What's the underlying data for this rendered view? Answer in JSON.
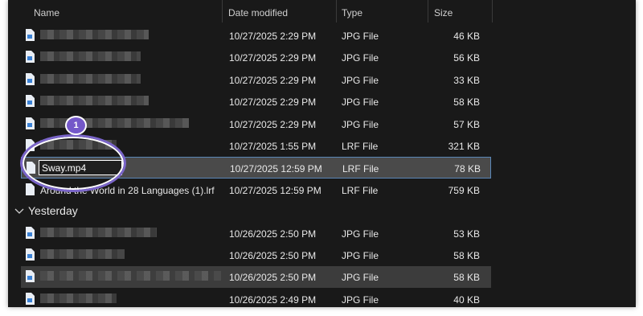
{
  "header": {
    "name": "Name",
    "date_modified": "Date modified",
    "type": "Type",
    "size": "Size"
  },
  "rows_top": [
    {
      "date": "10/27/2025 2:29 PM",
      "type": "JPG File",
      "size": "46 KB"
    },
    {
      "date": "10/27/2025 2:29 PM",
      "type": "JPG File",
      "size": "56 KB"
    },
    {
      "date": "10/27/2025 2:29 PM",
      "type": "JPG File",
      "size": "33 KB"
    },
    {
      "date": "10/27/2025 2:29 PM",
      "type": "JPG File",
      "size": "58 KB"
    },
    {
      "date": "10/27/2025 2:29 PM",
      "type": "JPG File",
      "size": "57 KB"
    },
    {
      "date": "10/27/2025 1:55 PM",
      "type": "LRF File",
      "size": "321 KB"
    },
    {
      "name": "Sway.mp4",
      "date": "10/27/2025 12:59 PM",
      "type": "LRF File",
      "size": "78 KB"
    },
    {
      "name": "Around the World in 28 Languages (1).lrf",
      "date": "10/27/2025 12:59 PM",
      "type": "LRF File",
      "size": "759 KB"
    }
  ],
  "group_label": "Yesterday",
  "rows_yesterday": [
    {
      "date": "10/26/2025 2:50 PM",
      "type": "JPG File",
      "size": "53 KB"
    },
    {
      "date": "10/26/2025 2:50 PM",
      "type": "JPG File",
      "size": "58 KB"
    },
    {
      "date": "10/26/2025 2:50 PM",
      "type": "JPG File",
      "size": "58 KB"
    },
    {
      "date": "10/26/2025 2:49 PM",
      "type": "JPG File",
      "size": "40 KB"
    }
  ],
  "annotation": {
    "badge": "1"
  },
  "colors": {
    "selected_border": "#5a86b7",
    "highlight": "#7a65c9"
  }
}
